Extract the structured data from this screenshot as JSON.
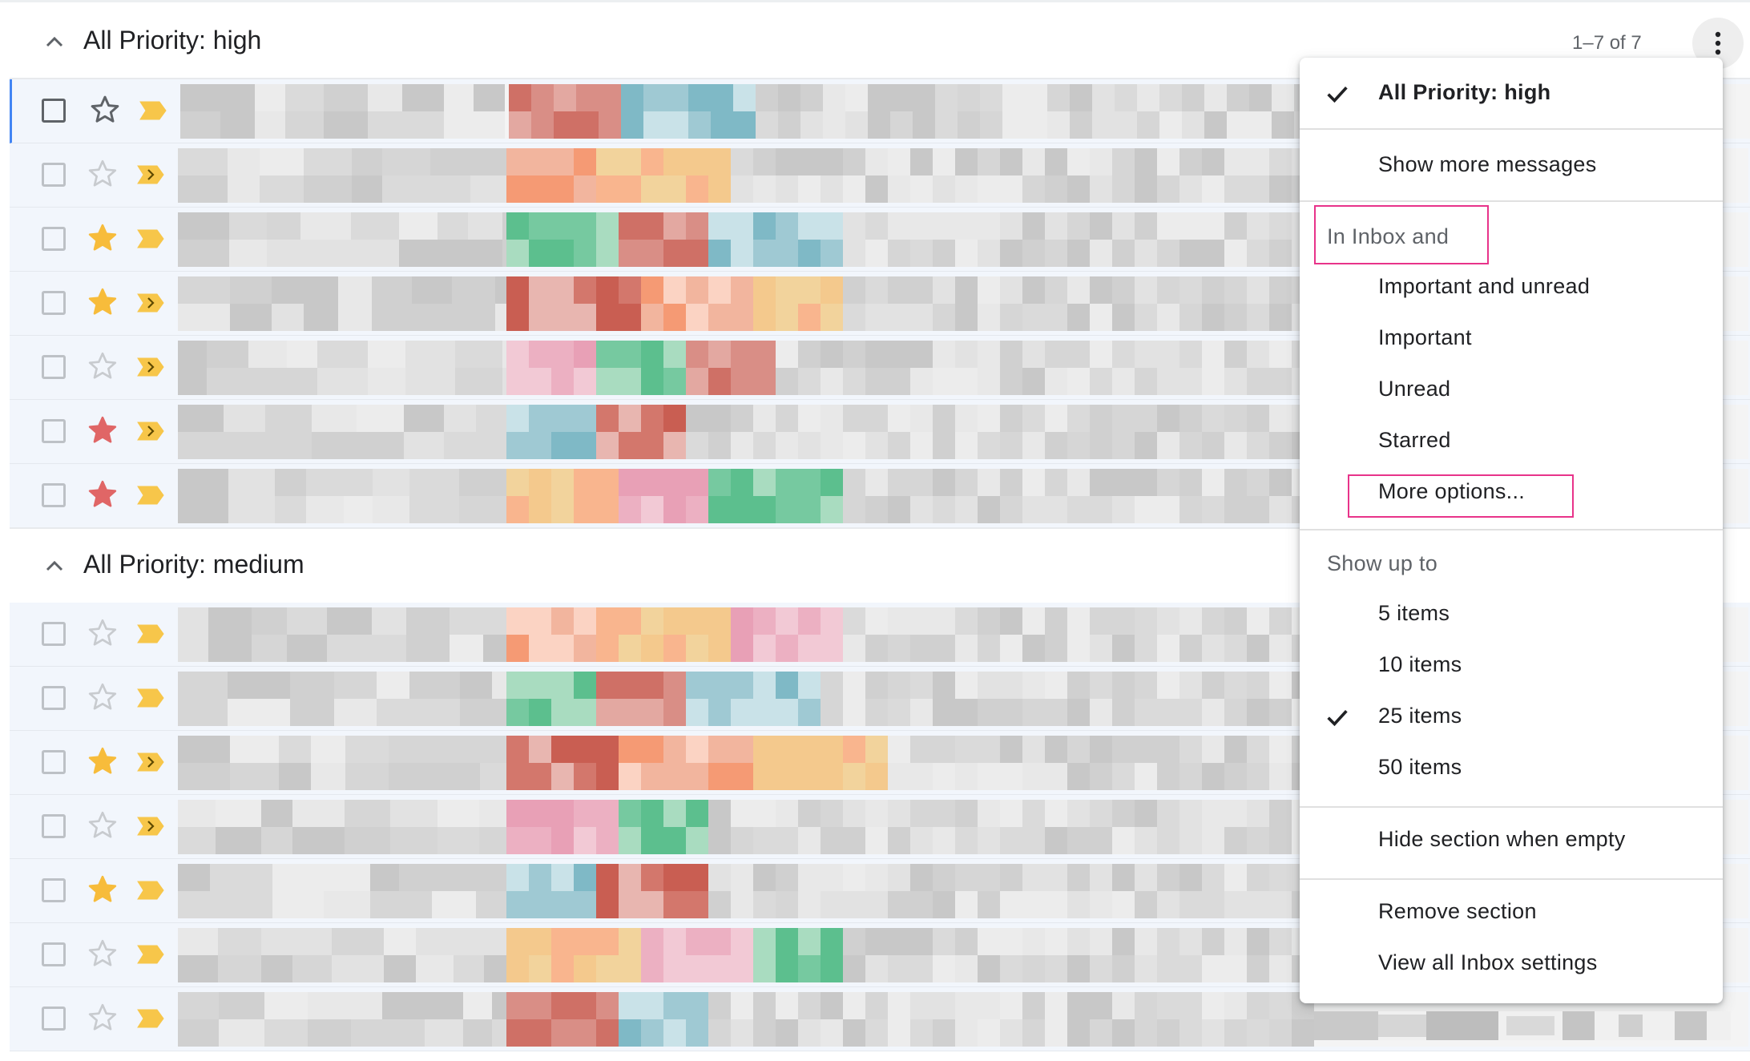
{
  "sections": [
    {
      "title": "All Priority: high",
      "count": "1–7 of 7"
    },
    {
      "title": "All Priority: medium"
    }
  ],
  "menu": {
    "items": [
      {
        "label": "All Priority: high",
        "checked": true
      },
      {
        "label": "Show more messages"
      },
      {
        "label": "In Inbox and"
      },
      {
        "label": "Important and unread"
      },
      {
        "label": "Important"
      },
      {
        "label": "Unread"
      },
      {
        "label": "Starred"
      },
      {
        "label": "More options..."
      },
      {
        "label": "Show up to"
      },
      {
        "label": "5 items"
      },
      {
        "label": "10 items"
      },
      {
        "label": "25 items",
        "checked": true
      },
      {
        "label": "50 items"
      },
      {
        "label": "Hide section when empty"
      },
      {
        "label": "Remove section"
      },
      {
        "label": "View all Inbox settings"
      }
    ]
  },
  "rows_high": [
    {
      "star": "outline-dark",
      "important": "filled"
    },
    {
      "star": "outline",
      "important": "arrow"
    },
    {
      "star": "filled-yellow",
      "important": "filled"
    },
    {
      "star": "filled-yellow",
      "important": "arrow"
    },
    {
      "star": "outline",
      "important": "arrow"
    },
    {
      "star": "filled-red",
      "important": "arrow"
    },
    {
      "star": "filled-red",
      "important": "filled"
    }
  ],
  "rows_medium": [
    {
      "star": "outline",
      "important": "filled"
    },
    {
      "star": "outline",
      "important": "filled"
    },
    {
      "star": "filled-yellow",
      "important": "arrow"
    },
    {
      "star": "outline",
      "important": "arrow"
    },
    {
      "star": "filled-yellow",
      "important": "filled"
    },
    {
      "star": "outline",
      "important": "filled"
    },
    {
      "star": "outline",
      "important": "filled"
    }
  ],
  "colors": {
    "accent": "#4285f4",
    "highlight": "#e8338a",
    "star_yellow": "#f7bc3b",
    "star_red": "#e06666",
    "important": "#f4b400"
  },
  "icons": [
    "chevron-up-icon",
    "more-vert-icon",
    "check-icon",
    "star-icon",
    "important-marker-icon",
    "checkbox-icon"
  ]
}
